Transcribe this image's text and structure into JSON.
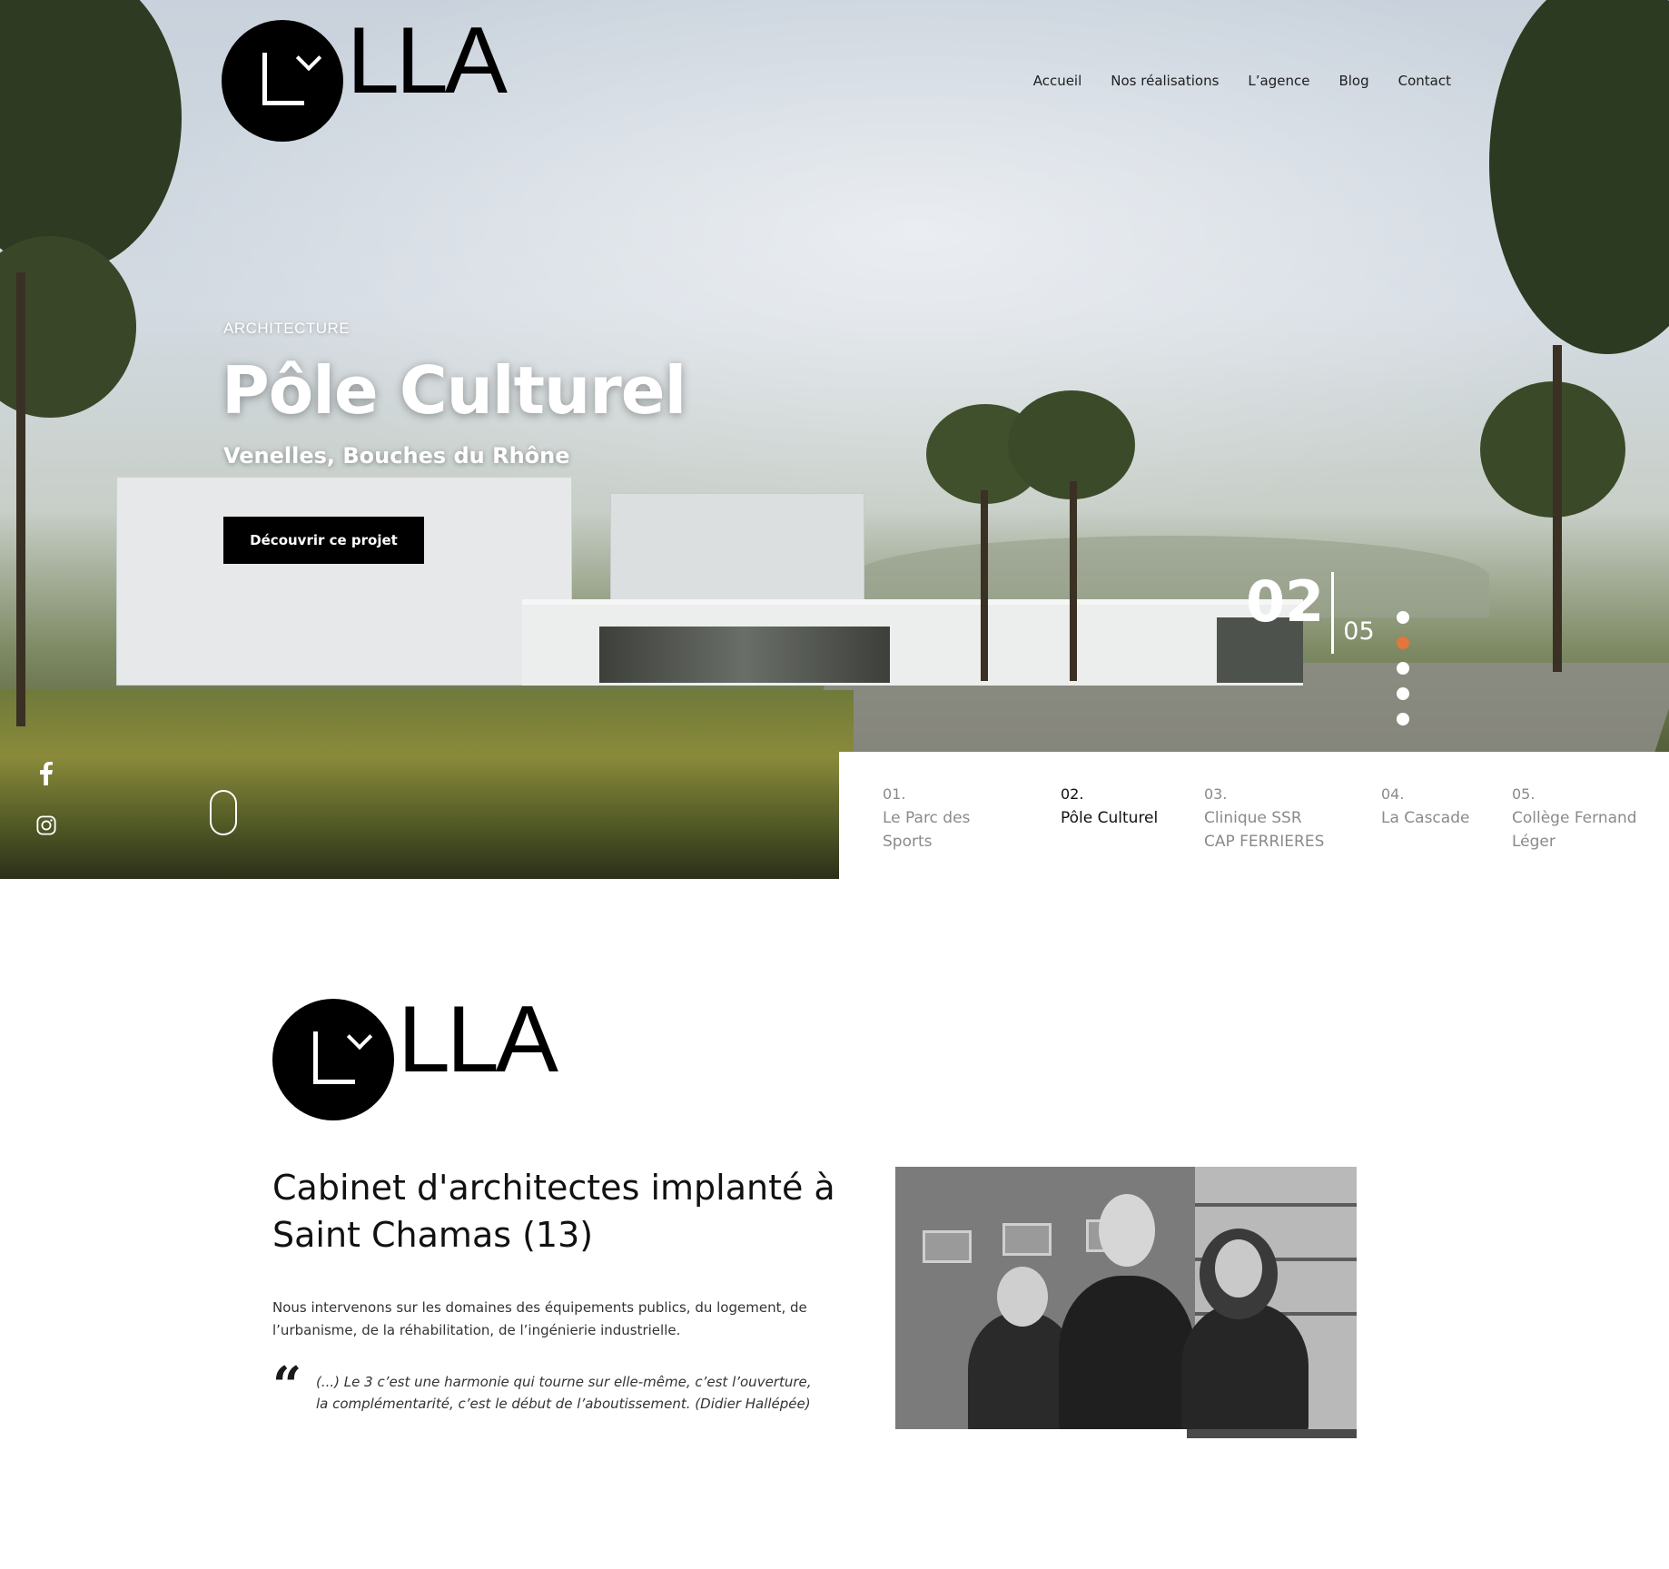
{
  "brand": {
    "logo_text": "LLA"
  },
  "nav": {
    "items": [
      "Accueil",
      "Nos réalisations",
      "L’agence",
      "Blog",
      "Contact"
    ]
  },
  "hero": {
    "category": "ARCHITECTURE",
    "title": "Pôle Culturel",
    "subtitle": "Venelles, Bouches du Rhône",
    "cta_label": "Découvrir ce projet",
    "counter_current": "02",
    "counter_total": "05",
    "active_dot_index": 1,
    "dot_count": 5,
    "accent_color": "#e2763c"
  },
  "social": {
    "icons": [
      "facebook-icon",
      "instagram-icon"
    ]
  },
  "slides": [
    {
      "num": "01.",
      "label_line1": "Le Parc des",
      "label_line2": "Sports"
    },
    {
      "num": "02.",
      "label_line1": "Pôle Culturel",
      "label_line2": ""
    },
    {
      "num": "03.",
      "label_line1": "Clinique SSR",
      "label_line2": "CAP FERRIERES"
    },
    {
      "num": "04.",
      "label_line1": "La Cascade",
      "label_line2": ""
    },
    {
      "num": "05.",
      "label_line1": "Collège Fernand",
      "label_line2": "Léger"
    }
  ],
  "about": {
    "title": "Cabinet d'architectes implanté à Saint Chamas (13)",
    "text": "Nous intervenons sur les domaines des équipements publics, du logement, de l’urbanisme, de la réhabilitation, de l’ingénierie industrielle.",
    "quote_mark": "“",
    "quote": "(...) Le 3 c’est une harmonie qui tourne sur elle-même, c’est l’ouverture, la complémentarité, c’est le début de l’aboutissement. (Didier Hallépée)"
  }
}
